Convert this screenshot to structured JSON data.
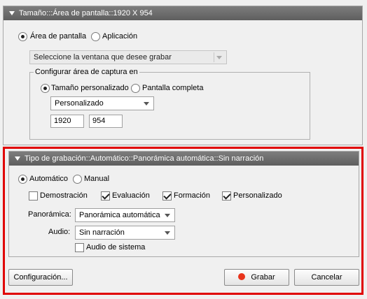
{
  "area_panel": {
    "header": "Tamaño:::Área de pantalla::1920 X 954",
    "radio_screen": "Área de pantalla",
    "radio_app": "Aplicación",
    "window_select": "Seleccione la ventana que desee grabar",
    "capture_group": {
      "legend": "Configurar área de captura en",
      "radio_custom": "Tamaño personalizado",
      "radio_full": "Pantalla completa",
      "size_select": "Personalizado",
      "width": "1920",
      "height": "954"
    }
  },
  "recording_panel": {
    "header": "Tipo de grabación::Automático::Panorámica automática::Sin narración",
    "radio_auto": "Automático",
    "radio_manual": "Manual",
    "modes": {
      "demo": "Demostración",
      "evaluation": "Evaluación",
      "training": "Formación",
      "custom": "Personalizado"
    },
    "panning_label": "Panorámica:",
    "panning_value": "Panorámica automática",
    "audio_label": "Audio:",
    "audio_value": "Sin narración",
    "system_audio": "Audio de sistema"
  },
  "buttons": {
    "settings": "Configuración...",
    "record": "Grabar",
    "cancel": "Cancelar"
  },
  "colors": {
    "highlight": "#e00000",
    "record_dot": "#e8341c",
    "header_bg": "#6e6e6e"
  }
}
